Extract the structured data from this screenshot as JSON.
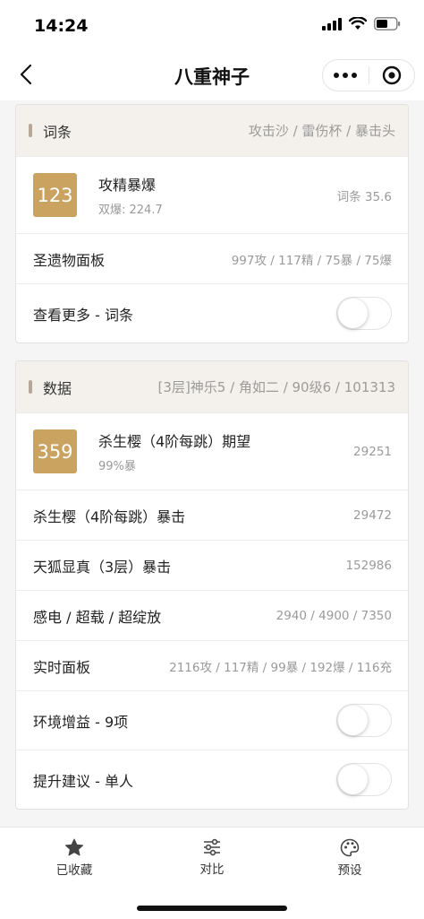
{
  "status": {
    "time": "14:24"
  },
  "nav": {
    "title": "八重神子"
  },
  "entries": {
    "title": "词条",
    "meta": "攻击沙 / 雷伤杯 / 暴击头",
    "score": {
      "badge": "123",
      "name": "攻精暴爆",
      "sub": "双爆: 224.7",
      "value": "词条 35.6"
    },
    "panel": {
      "label": "圣遗物面板",
      "value": "997攻 / 117精 / 75暴 / 75爆"
    },
    "more": {
      "label": "查看更多 - 词条",
      "on": false
    }
  },
  "data": {
    "title": "数据",
    "meta": "[3层]神乐5 / 角如二 / 90级6 / 101313",
    "score": {
      "badge": "359",
      "name": "杀生樱（4阶每跳）期望",
      "sub": "99%暴",
      "value": "29251"
    },
    "rows": [
      {
        "label": "杀生樱（4阶每跳）暴击",
        "value": "29472"
      },
      {
        "label": "天狐显真（3层）暴击",
        "value": "152986"
      },
      {
        "label": "感电 / 超载 / 超绽放",
        "value": "2940 / 4900 / 7350"
      },
      {
        "label": "实时面板",
        "value": "2116攻 / 117精 / 99暴 / 192爆 / 116充"
      }
    ],
    "env": {
      "label": "环境增益 - 9项",
      "on": false
    },
    "advice": {
      "label": "提升建议 - 单人",
      "on": false
    }
  },
  "tabs": [
    {
      "label": "已收藏",
      "icon": "star-icon"
    },
    {
      "label": "对比",
      "icon": "sliders-icon"
    },
    {
      "label": "预设",
      "icon": "palette-icon"
    }
  ],
  "colors": {
    "badge": "#c9a35f",
    "header_bg": "#f4f1ec",
    "accent_bar": "#b7a796"
  }
}
